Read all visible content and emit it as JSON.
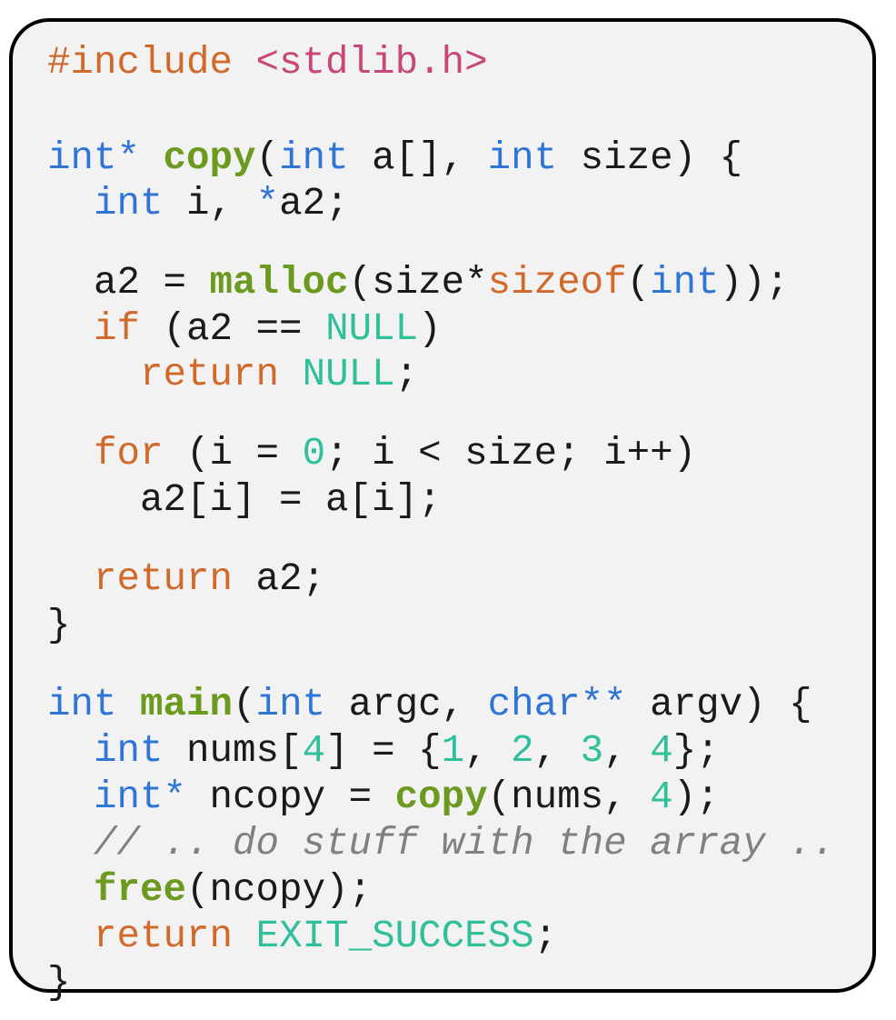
{
  "colors": {
    "background": "#f2f2f2",
    "border": "#000000",
    "keyword": "#2e75d6",
    "control": "#d0692a",
    "function": "#6b9a1f",
    "number": "#2fbf9b",
    "string": "#c8467a",
    "comment": "#808080",
    "plain": "#1a1a1a"
  },
  "code": {
    "lines": [
      [
        [
          "pre",
          "#include "
        ],
        [
          "str",
          "<stdlib.h>"
        ]
      ],
      [],
      [
        [
          "kw",
          "int*"
        ],
        [
          "pl",
          " "
        ],
        [
          "fn",
          "copy"
        ],
        [
          "pl",
          "("
        ],
        [
          "kw",
          "int"
        ],
        [
          "pl",
          " a[], "
        ],
        [
          "kw",
          "int"
        ],
        [
          "pl",
          " size) {"
        ]
      ],
      [
        [
          "pl",
          "  "
        ],
        [
          "kw",
          "int"
        ],
        [
          "pl",
          " i, "
        ],
        [
          "kw",
          "*"
        ],
        [
          "pl",
          "a2;"
        ]
      ],
      [],
      [
        [
          "pl",
          "  a2 = "
        ],
        [
          "fn",
          "malloc"
        ],
        [
          "pl",
          "(size*"
        ],
        [
          "ctl",
          "sizeof"
        ],
        [
          "pl",
          "("
        ],
        [
          "kw",
          "int"
        ],
        [
          "pl",
          "));"
        ]
      ],
      [
        [
          "pl",
          "  "
        ],
        [
          "ctl",
          "if"
        ],
        [
          "pl",
          " (a2 == "
        ],
        [
          "num",
          "NULL"
        ],
        [
          "pl",
          ")"
        ]
      ],
      [
        [
          "pl",
          "    "
        ],
        [
          "ctl",
          "return"
        ],
        [
          "pl",
          " "
        ],
        [
          "num",
          "NULL"
        ],
        [
          "pl",
          ";"
        ]
      ],
      [],
      [
        [
          "pl",
          "  "
        ],
        [
          "ctl",
          "for"
        ],
        [
          "pl",
          " (i = "
        ],
        [
          "num",
          "0"
        ],
        [
          "pl",
          "; i < size; i++)"
        ]
      ],
      [
        [
          "pl",
          "    a2[i] = a[i];"
        ]
      ],
      [],
      [
        [
          "pl",
          "  "
        ],
        [
          "ctl",
          "return"
        ],
        [
          "pl",
          " a2;"
        ]
      ],
      [
        [
          "pl",
          "}"
        ]
      ],
      [],
      [
        [
          "kw",
          "int"
        ],
        [
          "pl",
          " "
        ],
        [
          "fn",
          "main"
        ],
        [
          "pl",
          "("
        ],
        [
          "kw",
          "int"
        ],
        [
          "pl",
          " argc, "
        ],
        [
          "kw",
          "char**"
        ],
        [
          "pl",
          " argv) {"
        ]
      ],
      [
        [
          "pl",
          "  "
        ],
        [
          "kw",
          "int"
        ],
        [
          "pl",
          " nums["
        ],
        [
          "num",
          "4"
        ],
        [
          "pl",
          "] = {"
        ],
        [
          "num",
          "1"
        ],
        [
          "pl",
          ", "
        ],
        [
          "num",
          "2"
        ],
        [
          "pl",
          ", "
        ],
        [
          "num",
          "3"
        ],
        [
          "pl",
          ", "
        ],
        [
          "num",
          "4"
        ],
        [
          "pl",
          "};"
        ]
      ],
      [
        [
          "pl",
          "  "
        ],
        [
          "kw",
          "int*"
        ],
        [
          "pl",
          " ncopy = "
        ],
        [
          "fn",
          "copy"
        ],
        [
          "pl",
          "(nums, "
        ],
        [
          "num",
          "4"
        ],
        [
          "pl",
          ");"
        ]
      ],
      [
        [
          "pl",
          "  "
        ],
        [
          "cmt",
          "// .. do stuff with the array .."
        ]
      ],
      [
        [
          "pl",
          "  "
        ],
        [
          "fn",
          "free"
        ],
        [
          "pl",
          "(ncopy);"
        ]
      ],
      [
        [
          "pl",
          "  "
        ],
        [
          "ctl",
          "return"
        ],
        [
          "pl",
          " "
        ],
        [
          "num",
          "EXIT_SUCCESS"
        ],
        [
          "pl",
          ";"
        ]
      ],
      [
        [
          "pl",
          "}"
        ]
      ]
    ]
  }
}
